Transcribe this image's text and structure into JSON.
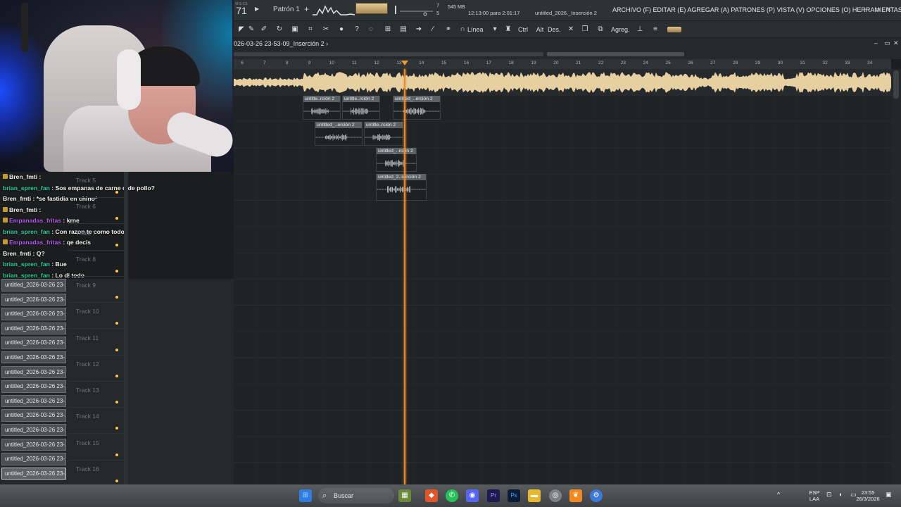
{
  "topbar": {
    "tempo": "71",
    "tempo_label": "M:S:CS",
    "pattern": "Patrón 1",
    "pattern_add": "+",
    "voices_top": "7",
    "voices_bottom": "5",
    "memory": "545 MB",
    "time": "12:13:00 para 2:01:17",
    "project": "untitled_2026._Inserción 2",
    "menu": "ARCHIVO (F) EDITAR (E) AGREGAR (A) PATRONES (P) VISTA (V) OPCIONES (O) HERRAMIENTAS (T) AYUDA",
    "minimize": "–",
    "maximize": "▭",
    "close": "✕"
  },
  "toolbar": {
    "line_label": "Línea",
    "ctrl_label": "Ctrl",
    "alt_label": "Alt",
    "des_label": "Des.",
    "agreg_label": "Agreg."
  },
  "playlist": {
    "title": "026-03-26 23-53-09_Inserción 2",
    "title_arrow": "›",
    "minimize": "–",
    "maximize": "▭",
    "close": "✕"
  },
  "ruler": [
    "6",
    "7",
    "8",
    "9",
    "10",
    "11",
    "12",
    "13",
    "14",
    "15",
    "16",
    "17",
    "18",
    "19",
    "20",
    "21",
    "22",
    "23",
    "24",
    "25",
    "26",
    "27",
    "28",
    "29",
    "30",
    "31",
    "32",
    "33",
    "34"
  ],
  "clips": [
    {
      "label": "untitle..rción 2"
    },
    {
      "label": "untitle..rción 2"
    },
    {
      "label": "untitled_..erción 2"
    },
    {
      "label": "untitled_..erción 2"
    },
    {
      "label": "untitle..rción 2"
    },
    {
      "label": "untitled_..rción 2"
    },
    {
      "label": "untitled_2..serción 2"
    }
  ],
  "chat": [
    {
      "user": "Bren_fmti",
      "user_color": "#f0f0f0",
      "msg": "",
      "badge": true
    },
    {
      "user": "brian_spren_fan",
      "user_color": "#2ad19b",
      "msg": "Sos empanas de carne o de pollo?",
      "badge": false
    },
    {
      "user": "Bren_fmti",
      "user_color": "#f0f0f0",
      "msg": "*se fastidia en chino*",
      "badge": false
    },
    {
      "user": "Bren_fmti",
      "user_color": "#f0f0f0",
      "msg": "",
      "badge": true
    },
    {
      "user": "Empanadas_fritas",
      "user_color": "#b05cf0",
      "msg": "krne",
      "badge": true
    },
    {
      "user": "brian_spren_fan",
      "user_color": "#2ad19b",
      "msg": "Con razon te como todo",
      "badge": false
    },
    {
      "user": "Empanadas_fritas",
      "user_color": "#b05cf0",
      "msg": "qe decis",
      "badge": true
    },
    {
      "user": "Bren_fmti",
      "user_color": "#f0f0f0",
      "msg": "Q?",
      "badge": false
    },
    {
      "user": "brian_spren_fan",
      "user_color": "#2ad19b",
      "msg": "Bue",
      "badge": false
    },
    {
      "user": "brian_spren_fan",
      "user_color": "#2ad19b",
      "msg": "Lo di todo",
      "badge": false
    }
  ],
  "clip_list": [
    "untitled_2026-03-26 23-...",
    "untitled_2026-03-26 23-...",
    "untitled_2026-03-26 23-...",
    "untitled_2026-03-26 23-...",
    "untitled_2026-03-26 23-...",
    "untitled_2026-03-26 23-...",
    "untitled_2026-03-26 23-...",
    "untitled_2026-03-26 23-...",
    "untitled_2026-03-26 23-...",
    "untitled_2026-03-26 23-...",
    "untitled_2026-03-26 23-...",
    "untitled_2026-03-26 23-...",
    "untitled_2026-03-26 23-...",
    "untitled_2026-03-26 23-..."
  ],
  "tracks": [
    "Track 5",
    "Track 6",
    "Track 7",
    "Track 8",
    "Track 9",
    "Track 10",
    "Track 11",
    "Track 12",
    "Track 13",
    "Track 14",
    "Track 15",
    "Track 16"
  ],
  "taskbar": {
    "search": "Buscar",
    "lang_top": "ESP",
    "lang_bottom": "LAA",
    "clock_time": "23:55",
    "clock_date": "26/3/2026"
  },
  "colors": {
    "accent": "#f09a2a",
    "waveform": "#e6cfa0"
  }
}
